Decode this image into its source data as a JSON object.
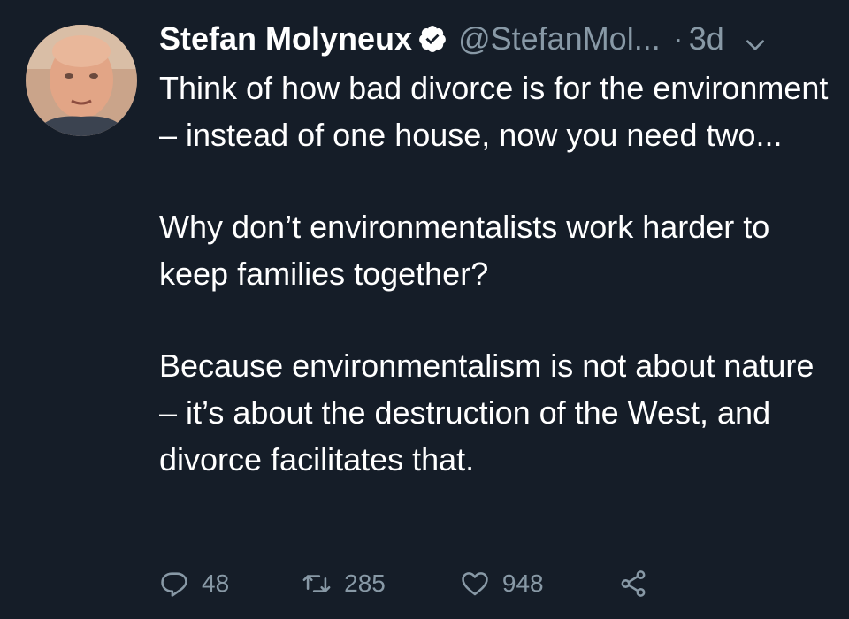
{
  "tweet": {
    "author": {
      "name": "Stefan Molyneux",
      "handle": "@StefanMol...",
      "verified": true
    },
    "separator": "·",
    "time": "3d",
    "paragraphs": [
      "Think of how bad divorce is for the environment – instead of one house, now you need two...",
      "Why don’t environmentalists work harder to keep families together?",
      "Because environmentalism is not about nature – it’s about the destruction of the West, and divorce facilitates that."
    ],
    "actions": {
      "reply_count": "48",
      "retweet_count": "285",
      "like_count": "948"
    }
  },
  "icons": {
    "verified": "verified-badge-icon",
    "menu": "chevron-down-icon",
    "reply": "reply-icon",
    "retweet": "retweet-icon",
    "like": "heart-icon",
    "share": "share-icon"
  },
  "colors": {
    "background": "#151d28",
    "text": "#ffffff",
    "muted": "#8899a6"
  }
}
